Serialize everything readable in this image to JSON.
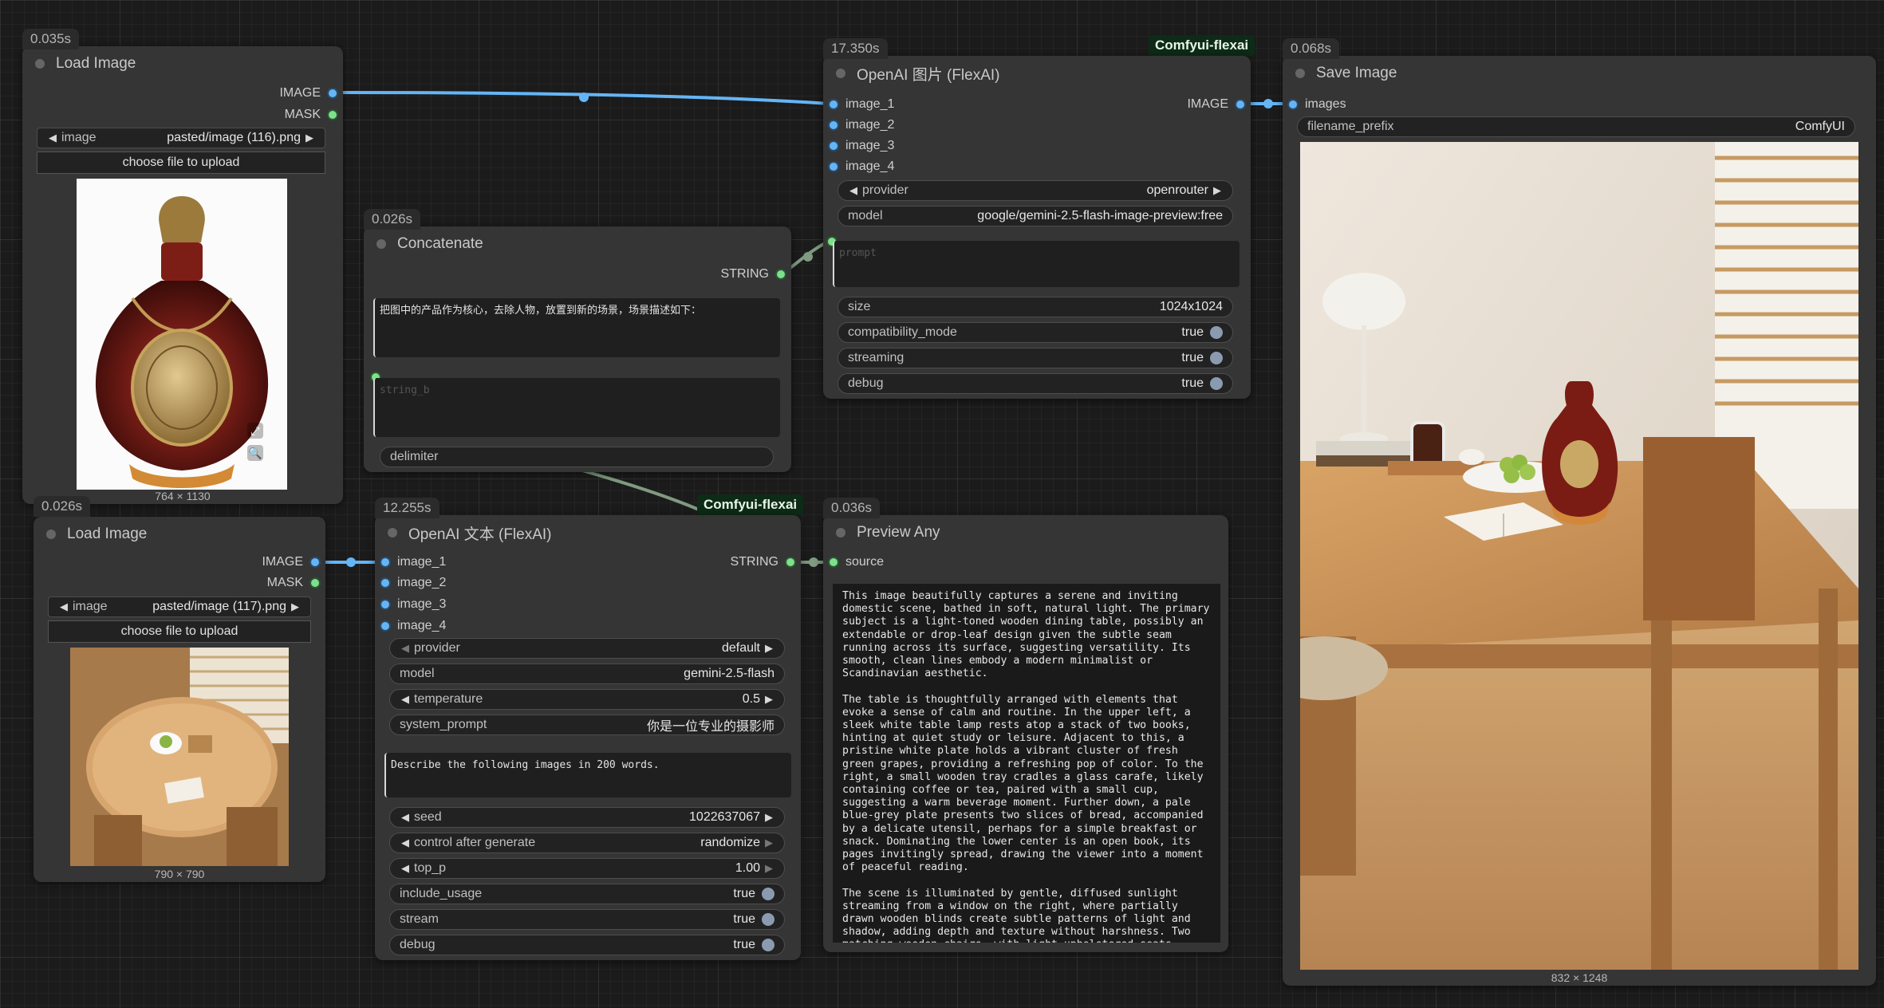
{
  "colors": {
    "canvas": "#1b1b1b",
    "node": "#353535",
    "image_link": "#64b5f6",
    "string_link": "#7f9a80",
    "tag_bg": "#0d2b16"
  },
  "tags": {
    "openai_image": "Comfyui-flexai",
    "openai_text": "Comfyui-flexai"
  },
  "load1": {
    "timing": "0.035s",
    "title": "Load Image",
    "out_image": "IMAGE",
    "out_mask": "MASK",
    "image_label": "image",
    "image_value": "pasted/image (116).png",
    "upload_label": "choose file to upload",
    "dims": "764 × 1130",
    "preview_icon": "bottle-icon"
  },
  "load2": {
    "timing": "0.026s",
    "title": "Load Image",
    "out_image": "IMAGE",
    "out_mask": "MASK",
    "image_label": "image",
    "image_value": "pasted/image (117).png",
    "upload_label": "choose file to upload",
    "dims": "790 × 790"
  },
  "concat": {
    "timing": "0.026s",
    "title": "Concatenate",
    "out_string": "STRING",
    "text_a": "把图中的产品作为核心，去除人物，放置到新的场景，场景描述如下：",
    "text_b_placeholder": "string_b",
    "delimiter_label": "delimiter",
    "delimiter_value": ""
  },
  "openai_image": {
    "timing": "17.350s",
    "title": "OpenAI 图片 (FlexAI)",
    "inputs": [
      "image_1",
      "image_2",
      "image_3",
      "image_4"
    ],
    "output": "IMAGE",
    "provider_label": "provider",
    "provider_value": "openrouter",
    "model_label": "model",
    "model_value": "google/gemini-2.5-flash-image-preview:free",
    "prompt_placeholder": "prompt",
    "size_label": "size",
    "size_value": "1024x1024",
    "compat_label": "compatibility_mode",
    "compat_value": "true",
    "streaming_label": "streaming",
    "streaming_value": "true",
    "debug_label": "debug",
    "debug_value": "true"
  },
  "openai_text": {
    "timing": "12.255s",
    "title": "OpenAI 文本 (FlexAI)",
    "inputs": [
      "image_1",
      "image_2",
      "image_3",
      "image_4"
    ],
    "output": "STRING",
    "provider_label": "provider",
    "provider_value": "default",
    "model_label": "model",
    "model_value": "gemini-2.5-flash",
    "temperature_label": "temperature",
    "temperature_value": "0.5",
    "system_prompt_label": "system_prompt",
    "system_prompt_value": "你是一位专业的摄影师",
    "prompt_text": "Describe the following images in 200 words.",
    "seed_label": "seed",
    "seed_value": "1022637067",
    "control_label": "control after generate",
    "control_value": "randomize",
    "top_p_label": "top_p",
    "top_p_value": "1.00",
    "include_usage_label": "include_usage",
    "include_usage_value": "true",
    "stream_label": "stream",
    "stream_value": "true",
    "debug_label": "debug",
    "debug_value": "true"
  },
  "preview_any": {
    "timing": "0.036s",
    "title": "Preview Any",
    "input": "source",
    "text": "This image beautifully captures a serene and inviting\ndomestic scene, bathed in soft, natural light. The primary\nsubject is a light-toned wooden dining table, possibly an\nextendable or drop-leaf design given the subtle seam\nrunning across its surface, suggesting versatility. Its\nsmooth, clean lines embody a modern minimalist or\nScandinavian aesthetic.\n\nThe table is thoughtfully arranged with elements that\nevoke a sense of calm and routine. In the upper left, a\nsleek white table lamp rests atop a stack of two books,\nhinting at quiet study or leisure. Adjacent to this, a\npristine white plate holds a vibrant cluster of fresh\ngreen grapes, providing a refreshing pop of color. To the\nright, a small wooden tray cradles a glass carafe, likely\ncontaining coffee or tea, paired with a small cup,\nsuggesting a warm beverage moment. Further down, a pale\nblue-grey plate presents two slices of bread, accompanied\nby a delicate utensil, perhaps for a simple breakfast or\nsnack. Dominating the lower center is an open book, its\npages invitingly spread, drawing the viewer into a moment\nof peaceful reading.\n\nThe scene is illuminated by gentle, diffused sunlight\nstreaming from a window on the right, where partially\ndrawn wooden blinds create subtle patterns of light and\nshadow, adding depth and texture without harshness. Two\nmatching wooden chairs, with light upholstered seats,"
  },
  "save_image": {
    "timing": "0.068s",
    "title": "Save Image",
    "input": "images",
    "prefix_label": "filename_prefix",
    "prefix_value": "ComfyUI",
    "dims": "832 × 1248"
  }
}
